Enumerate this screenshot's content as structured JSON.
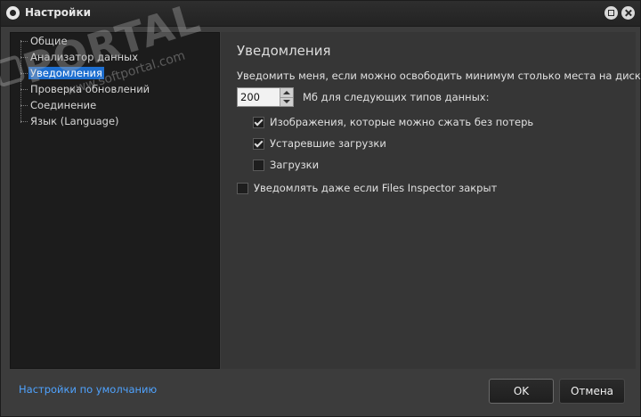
{
  "window": {
    "title": "Настройки"
  },
  "sidebar": {
    "items": [
      {
        "label": "Общие",
        "selected": false
      },
      {
        "label": "Анализатор данных",
        "selected": false
      },
      {
        "label": "Уведомления",
        "selected": true
      },
      {
        "label": "Проверка обновлений",
        "selected": false
      },
      {
        "label": "Соединение",
        "selected": false
      },
      {
        "label": "Язык (Language)",
        "selected": false
      }
    ]
  },
  "main": {
    "heading": "Уведомления",
    "intro": "Уведомить меня, если можно освободить минимум столько места на диске:",
    "size_value": "200",
    "size_label": "Мб для следующих типов данных:",
    "options": [
      {
        "label": "Изображения, которые можно сжать без потерь",
        "checked": true
      },
      {
        "label": "Устаревшие загрузки",
        "checked": true
      },
      {
        "label": "Загрузки",
        "checked": false
      }
    ],
    "always_notify": {
      "label": "Уведомлять даже если Files Inspector закрыт",
      "checked": false
    }
  },
  "footer": {
    "defaults_link": "Настройки по умолчанию",
    "ok_label": "OK",
    "cancel_label": "Отмена"
  },
  "watermark": {
    "text": "PORTAL",
    "trademark": "™",
    "url": "www.softportal.com"
  },
  "colors": {
    "selection": "#1e6fd0",
    "link": "#4fa3ff"
  }
}
